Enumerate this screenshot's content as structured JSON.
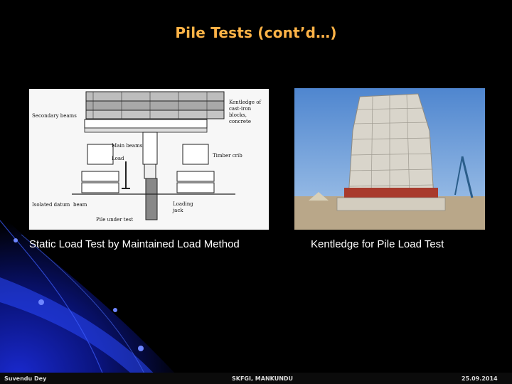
{
  "slide": {
    "title": "Pile Tests (cont’d…)"
  },
  "figures": {
    "diagram": {
      "labels": {
        "secondary_beams": "Secondary beams",
        "kentledge_1": "Kentledge of",
        "kentledge_2": "cast-iron",
        "kentledge_3": "blocks,",
        "kentledge_4": "concrete",
        "main_beams": "Main beams",
        "load": "Load",
        "timber_crib": "Timber crib",
        "isolated_datum": "Isolated datum",
        "beam": "beam",
        "pile_under_test": "Pile under test",
        "loading_1": "Loading",
        "loading_2": "jack"
      }
    },
    "photo": {}
  },
  "captions": {
    "left": "Static Load Test by Maintained Load Method",
    "right": "Kentledge for Pile Load Test"
  },
  "footer": {
    "left": "Suvendu Dey",
    "center": "SKFGI, MANKUNDU",
    "right": "25.09.2014"
  },
  "colors": {
    "background": "#000000",
    "title": "#ffb347",
    "caption": "#ffffff",
    "accent_blue": "#1a2fd0"
  }
}
